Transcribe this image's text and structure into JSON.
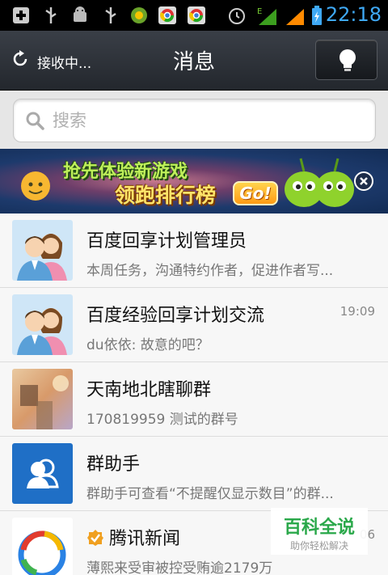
{
  "status_bar": {
    "time": "22:18",
    "icons": [
      "usb-add-icon",
      "usb-icon",
      "android-debug-icon",
      "usb-icon",
      "app-notification-icon",
      "chrome-icon",
      "chrome-icon",
      "alarm-icon",
      "signal-e-icon",
      "signal-icon",
      "battery-charging-icon"
    ]
  },
  "header": {
    "refresh_status": "接收中...",
    "title": "消息"
  },
  "search": {
    "placeholder": "搜索"
  },
  "banner": {
    "line1": "抢先体验新游戏",
    "line2": "领跑排行榜",
    "cta": "Go!"
  },
  "conversations": [
    {
      "name": "百度回享计划管理员",
      "message": "本周任务，沟通特约作者，促进作者写...",
      "time": ""
    },
    {
      "name": "百度经验回享计划交流",
      "message": "du依依: 故意的吧？",
      "time": "19:09"
    },
    {
      "name": "天南地北瞎聊群",
      "message": "170819959 测试的群号",
      "time": ""
    },
    {
      "name": "群助手",
      "message": "群助手可查看“不提醒仅显示数目”的群...",
      "time": ""
    },
    {
      "name": "腾讯新闻",
      "message": "薄熙来受审被控受贿逾2179万",
      "time": "06"
    }
  ],
  "watermark": {
    "title": "百科全说",
    "subtitle": "助你轻松解决"
  },
  "colors": {
    "accent": "#3fa9f5",
    "titlebar": "#2d3137",
    "banner_green": "#bff05a"
  }
}
